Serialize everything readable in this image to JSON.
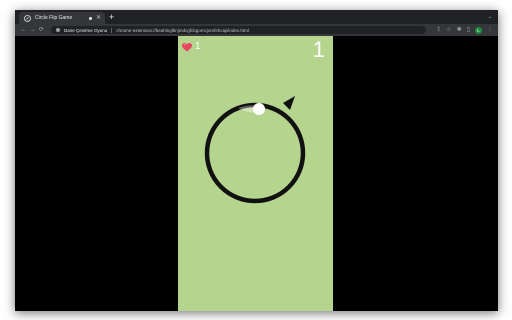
{
  "browser": {
    "tab": {
      "title": "Circle Flip Game"
    },
    "new_tab_symbol": "+",
    "tabs_menu_symbol": "⌄",
    "nav": {
      "back": "←",
      "forward": "→",
      "reload": "⟳"
    },
    "omnibox": {
      "site_label": "Daire Çevirme Oyunu",
      "url": "chrome-extension://beahlnglbnjmdcgfcbgomcjomfehcaji/index.html"
    },
    "toolbar_icons": {
      "share": "⇪",
      "bookmark": "☆",
      "extensions": "✱",
      "sidebar": "▯"
    },
    "profile_initial": "L",
    "menu_symbol": "⋮"
  },
  "game": {
    "lives": "1",
    "score": "1",
    "colors": {
      "background": "#b5d58e",
      "ring": "#111111",
      "ball": "#ffffff",
      "heart": "#e8455f"
    }
  }
}
